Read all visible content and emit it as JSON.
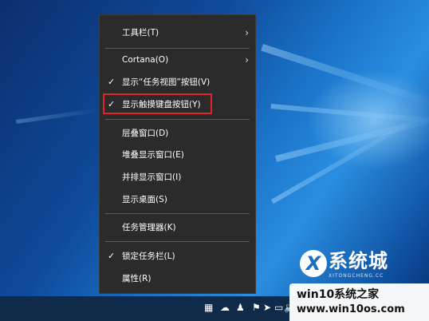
{
  "context_menu": {
    "items": [
      {
        "label": "工具栏(T)",
        "checked": false,
        "submenu": true
      },
      {
        "label": "Cortana(O)",
        "checked": false,
        "submenu": true
      },
      {
        "label": "显示“任务视图”按钮(V)",
        "checked": true,
        "submenu": false
      },
      {
        "label": "显示触摸键盘按钮(Y)",
        "checked": true,
        "submenu": false,
        "highlighted": true
      },
      {
        "label": "层叠窗口(D)",
        "checked": false,
        "submenu": false
      },
      {
        "label": "堆叠显示窗口(E)",
        "checked": false,
        "submenu": false
      },
      {
        "label": "并排显示窗口(I)",
        "checked": false,
        "submenu": false
      },
      {
        "label": "显示桌面(S)",
        "checked": false,
        "submenu": false
      },
      {
        "label": "任务管理器(K)",
        "checked": false,
        "submenu": false
      },
      {
        "label": "锁定任务栏(L)",
        "checked": true,
        "submenu": false
      },
      {
        "label": "属性(R)",
        "checked": false,
        "submenu": false
      }
    ],
    "check_glyph": "✓",
    "arrow_glyph": "›",
    "highlight_color": "#e0232d"
  },
  "taskbar": {
    "tray_icons": [
      "touch-keyboard-icon",
      "cloud-icon",
      "user-icon",
      "flag-icon",
      "telegram-icon",
      "network-icon",
      "volume-icon"
    ],
    "tray_glyphs": [
      "▦",
      "☁",
      "♟",
      "⚑",
      "➤",
      "▭",
      "🔈"
    ]
  },
  "watermark": {
    "logo_letter": "X",
    "title": "系统城",
    "subtitle": "XITONGCHENG.CC",
    "brand_line1": "win10系统之家",
    "brand_line2": "www.win10os.com"
  }
}
